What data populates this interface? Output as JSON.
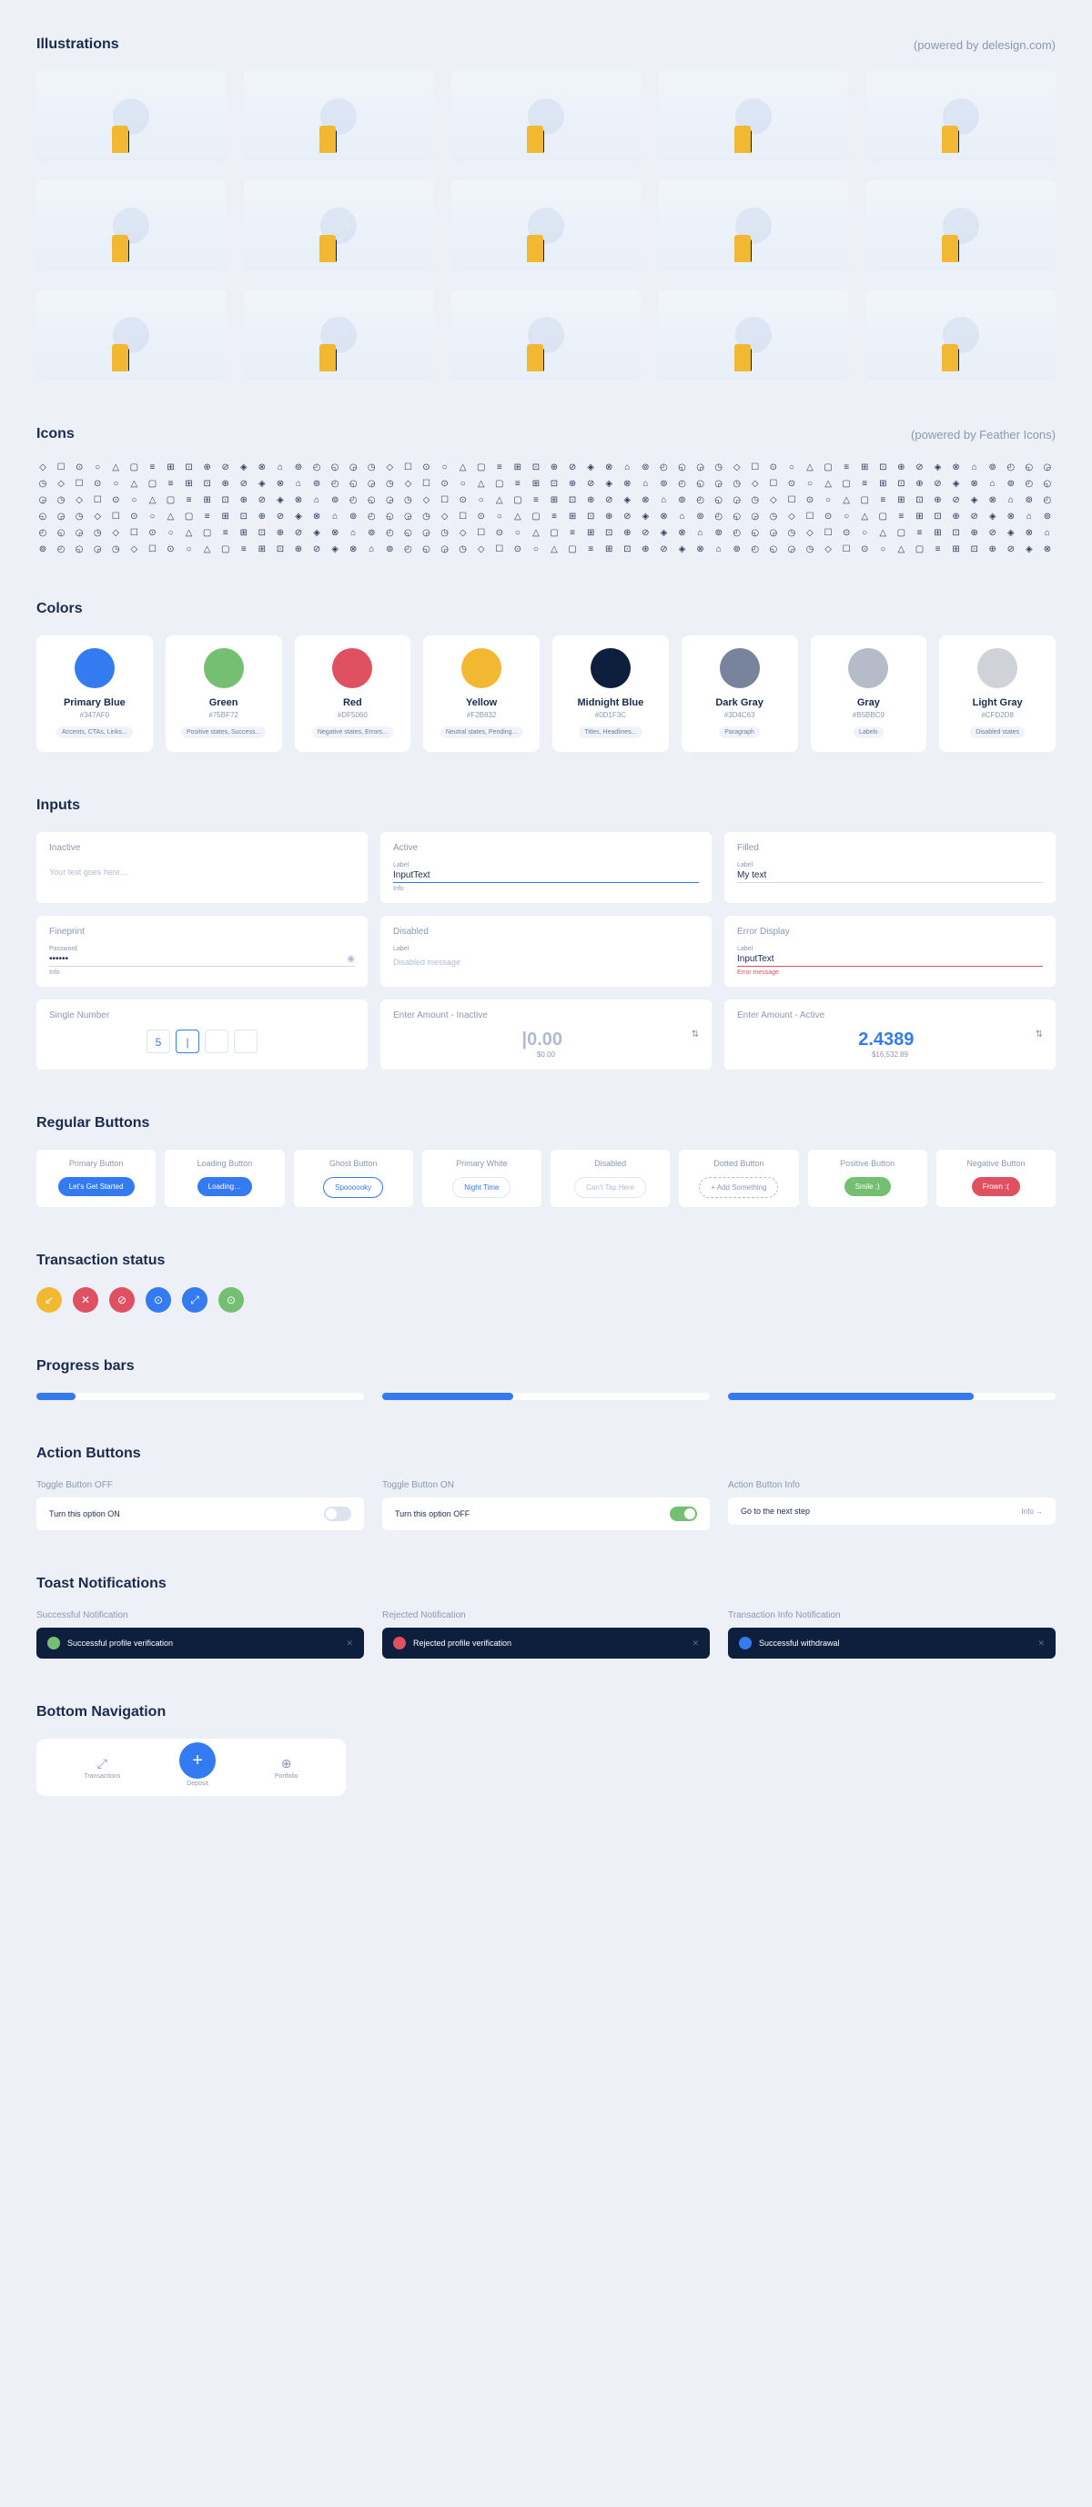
{
  "sections": {
    "illustrations": {
      "title": "Illustrations",
      "powered": "(powered by delesign.com)"
    },
    "icons": {
      "title": "Icons",
      "powered": "(powered by Feather Icons)"
    },
    "colors": {
      "title": "Colors"
    },
    "inputs": {
      "title": "Inputs"
    },
    "buttons": {
      "title": "Regular Buttons"
    },
    "tx": {
      "title": "Transaction status"
    },
    "progress": {
      "title": "Progress bars"
    },
    "actions": {
      "title": "Action Buttons"
    },
    "toasts": {
      "title": "Toast Notifications"
    },
    "bottomnav": {
      "title": "Bottom Navigation"
    }
  },
  "colors": [
    {
      "name": "Primary Blue",
      "hex": "#347AF0",
      "swatch": "#347af0",
      "desc": "Accents, CTAs, Links..."
    },
    {
      "name": "Green",
      "hex": "#75BF72",
      "swatch": "#75bf72",
      "desc": "Positive states, Success..."
    },
    {
      "name": "Red",
      "hex": "#DF5060",
      "swatch": "#df5060",
      "desc": "Negative states, Errors..."
    },
    {
      "name": "Yellow",
      "hex": "#F2B832",
      "swatch": "#f2b832",
      "desc": "Neutral states, Pending..."
    },
    {
      "name": "Midnight Blue",
      "hex": "#0D1F3C",
      "swatch": "#0d1f3c",
      "desc": "Titles, Headlines..."
    },
    {
      "name": "Dark Gray",
      "hex": "#3D4C63",
      "swatch": "#78839c",
      "desc": "Paragraph"
    },
    {
      "name": "Gray",
      "hex": "#B5BBC9",
      "swatch": "#b5bbc9",
      "desc": "Labels"
    },
    {
      "name": "Light Gray",
      "hex": "#CFD2D8",
      "swatch": "#cfd2d8",
      "desc": "Disabled states"
    }
  ],
  "inputs": {
    "inactive": {
      "title": "Inactive",
      "placeholder": "Your text goes here…"
    },
    "active": {
      "title": "Active",
      "label": "Label",
      "value": "InputText",
      "info": "Info"
    },
    "filled": {
      "title": "Filled",
      "label": "Label",
      "value": "My text"
    },
    "fineprint": {
      "title": "Fineprint",
      "label": "Password",
      "value": "••••••",
      "info": "Info"
    },
    "disabled": {
      "title": "Disabled",
      "label": "Label",
      "value": "Disabled message"
    },
    "error": {
      "title": "Error Display",
      "label": "Label",
      "value": "InputText",
      "error": "Error message"
    },
    "single": {
      "title": "Single Number",
      "d1": "5",
      "d2": "|"
    },
    "amt_inactive": {
      "title": "Enter Amount - Inactive",
      "value": "|0.00",
      "sub": "$0.00"
    },
    "amt_active": {
      "title": "Enter Amount - Active",
      "value": "2.4389",
      "sub": "$16,532.89"
    }
  },
  "buttons": [
    {
      "title": "Primary Button",
      "label": "Let's Get Started",
      "cls": "primary"
    },
    {
      "title": "Loading Button",
      "label": "Loading…",
      "cls": "primary"
    },
    {
      "title": "Ghost Button",
      "label": "Spoooooky",
      "cls": "ghost"
    },
    {
      "title": "Primary White",
      "label": "Night Time",
      "cls": "white"
    },
    {
      "title": "Disabled",
      "label": "Can't Tap Here",
      "cls": "disabled"
    },
    {
      "title": "Dotted Button",
      "label": "+ Add Something",
      "cls": "dotted"
    },
    {
      "title": "Positive Button",
      "label": "Smile :)",
      "cls": "green"
    },
    {
      "title": "Negative Button",
      "label": "Frown :(",
      "cls": "red"
    }
  ],
  "tx_glyphs": [
    "↙",
    "✕",
    "⊘",
    "⊙",
    "⤢",
    "⊙"
  ],
  "actions": {
    "off": {
      "title": "Toggle Button OFF",
      "label": "Turn this option ON"
    },
    "on": {
      "title": "Toggle Button ON",
      "label": "Turn this option OFF"
    },
    "info": {
      "title": "Action Button Info",
      "label": "Go to the next step",
      "link": "Info →"
    }
  },
  "toasts": {
    "success": {
      "title": "Successful Notification",
      "text": "Successful profile verification"
    },
    "reject": {
      "title": "Rejected Notification",
      "text": "Rejected profile verification"
    },
    "info": {
      "title": "Transaction Info Notification",
      "text": "Successful withdrawal"
    }
  },
  "bottomnav": {
    "transactions": "Transactions",
    "deposit": "Deposit",
    "portfolio": "Portfolio"
  }
}
